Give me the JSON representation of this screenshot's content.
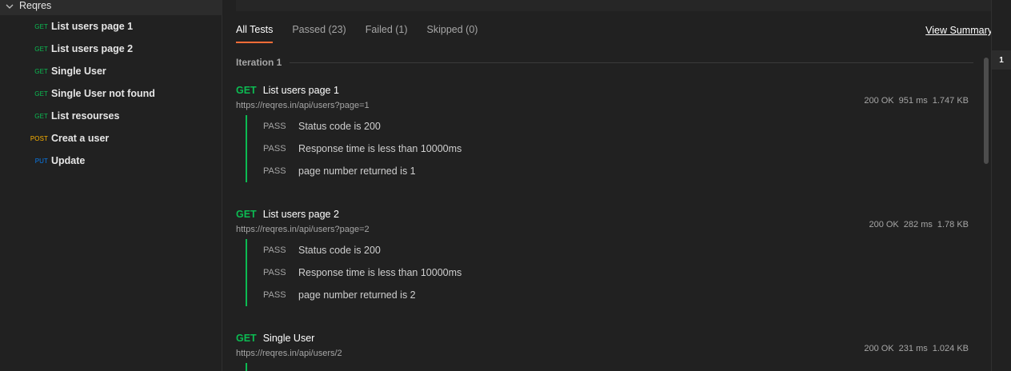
{
  "sidebar": {
    "collection": "Reqres",
    "requests": [
      {
        "method": "GET",
        "name": "List users page 1",
        "color": "#0cbb52"
      },
      {
        "method": "GET",
        "name": "List users page 2",
        "color": "#0cbb52"
      },
      {
        "method": "GET",
        "name": "Single User",
        "color": "#0cbb52"
      },
      {
        "method": "GET",
        "name": "Single User not found",
        "color": "#0cbb52"
      },
      {
        "method": "GET",
        "name": "List resourses",
        "color": "#0cbb52"
      },
      {
        "method": "POST",
        "name": "Creat a user",
        "color": "#ffb400"
      },
      {
        "method": "PUT",
        "name": "Update",
        "color": "#097bed"
      }
    ]
  },
  "tabs": [
    {
      "label": "All Tests",
      "active": true
    },
    {
      "label": "Passed (23)",
      "active": false
    },
    {
      "label": "Failed (1)",
      "active": false
    },
    {
      "label": "Skipped (0)",
      "active": false
    }
  ],
  "view_summary": "View Summary",
  "iteration_label": "Iteration 1",
  "iteration_number": "1",
  "results": [
    {
      "method": "GET",
      "name": "List users page 1",
      "url": "https://reqres.in/api/users?page=1",
      "status": "200 OK",
      "time": "951 ms",
      "size": "1.747 KB",
      "tests": [
        {
          "result": "PASS",
          "name": "Status code is 200"
        },
        {
          "result": "PASS",
          "name": "Response time is less than 10000ms"
        },
        {
          "result": "PASS",
          "name": "page number returned is 1"
        }
      ]
    },
    {
      "method": "GET",
      "name": "List users page 2",
      "url": "https://reqres.in/api/users?page=2",
      "status": "200 OK",
      "time": "282 ms",
      "size": "1.78 KB",
      "tests": [
        {
          "result": "PASS",
          "name": "Status code is 200"
        },
        {
          "result": "PASS",
          "name": "Response time is less than 10000ms"
        },
        {
          "result": "PASS",
          "name": "page number returned is 2"
        }
      ]
    },
    {
      "method": "GET",
      "name": "Single User",
      "url": "https://reqres.in/api/users/2",
      "status": "200 OK",
      "time": "231 ms",
      "size": "1.024 KB",
      "tests": []
    }
  ],
  "colors": {
    "accent": "#ff6c37",
    "pass": "#0cbb52"
  }
}
